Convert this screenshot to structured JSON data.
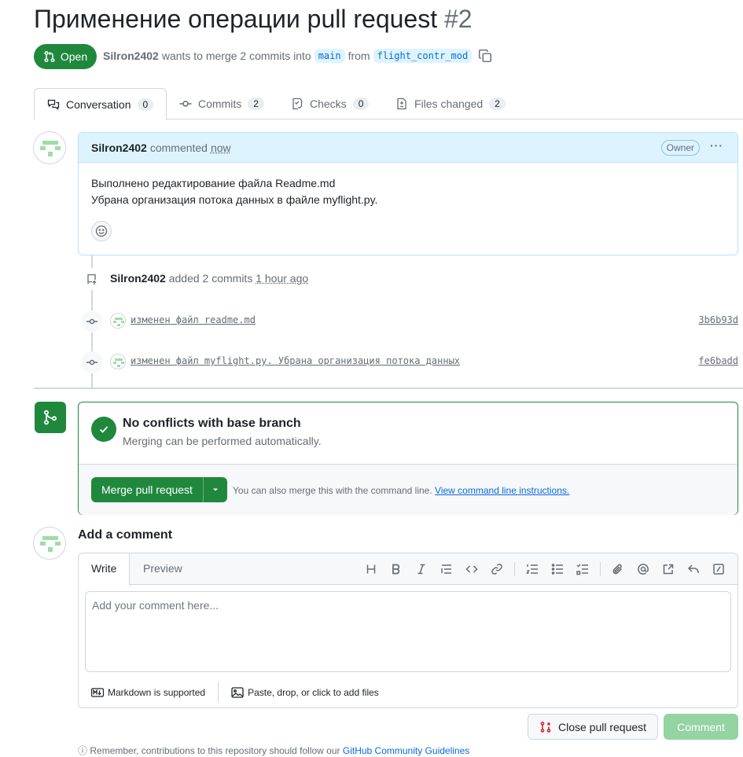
{
  "pr": {
    "title": "Применение операции pull request",
    "number": "#2",
    "state": "Open",
    "author": "Silron2402",
    "merge_text": "wants to merge 2 commits into",
    "base_branch": "main",
    "from_text": "from",
    "head_branch": "flight_contr_mod"
  },
  "tabs": [
    {
      "label": "Conversation",
      "count": "0",
      "icon": "comment-discussion-icon"
    },
    {
      "label": "Commits",
      "count": "2",
      "icon": "git-commit-icon"
    },
    {
      "label": "Checks",
      "count": "0",
      "icon": "checklist-icon"
    },
    {
      "label": "Files changed",
      "count": "2",
      "icon": "file-diff-icon"
    }
  ],
  "comment": {
    "author": "Silron2402",
    "action": "commented",
    "time": "now",
    "badge": "Owner",
    "line1": "Выполнено редактирование файла Readme.md",
    "line2": "Убрана организация потока данных в файле myflight.py."
  },
  "timeline": {
    "author": "Silron2402",
    "action": "added 2 commits",
    "time": "1 hour ago",
    "commits": [
      {
        "message": "изменен файл readme.md",
        "sha": "3b6b93d"
      },
      {
        "message": "изменен файл myflight.py. Убрана организация потока данных",
        "sha": "fe6badd"
      }
    ]
  },
  "merge": {
    "title": "No conflicts with base branch",
    "subtitle": "Merging can be performed automatically.",
    "button": "Merge pull request",
    "hint": "You can also merge this with the command line.",
    "hint_link": "View command line instructions."
  },
  "add_comment": {
    "title": "Add a comment",
    "tab_write": "Write",
    "tab_preview": "Preview",
    "placeholder": "Add your comment here...",
    "markdown_note": "Markdown is supported",
    "files_note": "Paste, drop, or click to add files",
    "close_button": "Close pull request",
    "comment_button": "Comment",
    "footer_note": "Remember, contributions to this repository should follow our",
    "footer_link": "GitHub Community Guidelines"
  },
  "colors": {
    "accent_green": "#1f883d",
    "link_blue": "#0969da",
    "highlight_blue": "#ddf4ff",
    "close_red": "#cf222e"
  }
}
